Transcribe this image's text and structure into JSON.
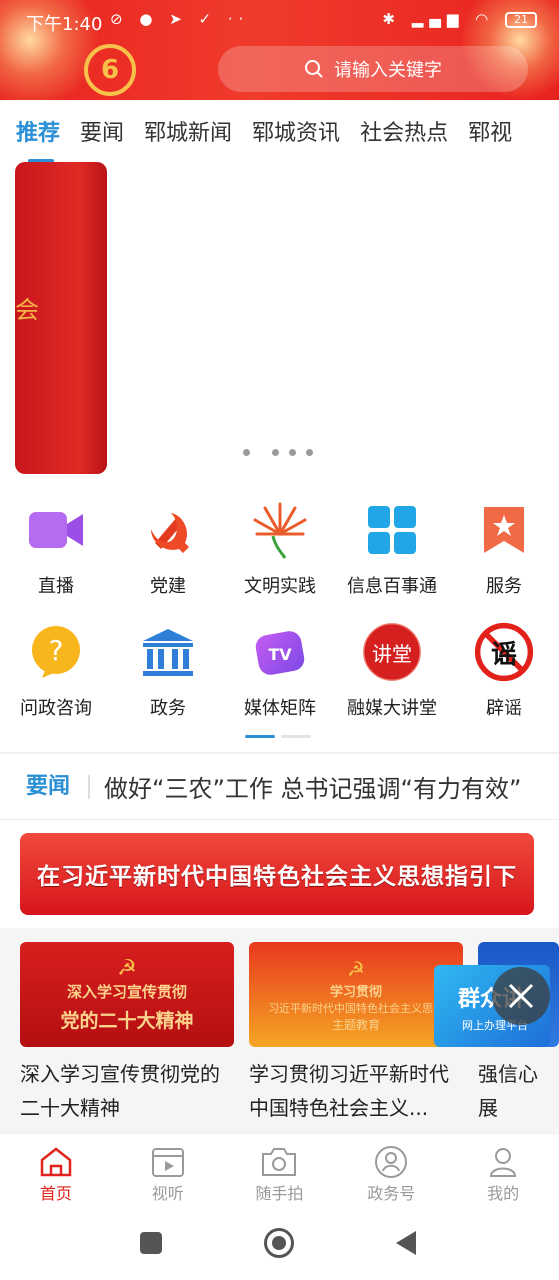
{
  "status_bar": {
    "time": "下午1:40",
    "battery": "21"
  },
  "header": {
    "logo_text": "6",
    "search_placeholder": "请输入关键字"
  },
  "tabs": [
    {
      "label": "推荐",
      "active": true
    },
    {
      "label": "要闻"
    },
    {
      "label": "郓城新闻"
    },
    {
      "label": "郓城资讯"
    },
    {
      "label": "社会热点"
    },
    {
      "label": "郓视"
    }
  ],
  "banner": {
    "text": "会"
  },
  "grid": [
    {
      "label": "直播",
      "icon": "video-icon"
    },
    {
      "label": "党建",
      "icon": "party-emblem-icon"
    },
    {
      "label": "文明实践",
      "icon": "civilization-icon"
    },
    {
      "label": "信息百事通",
      "icon": "grid-four-icon"
    },
    {
      "label": "服务",
      "icon": "bookmark-star-icon"
    },
    {
      "label": "问政咨询",
      "icon": "question-bubble-icon"
    },
    {
      "label": "政务",
      "icon": "government-building-icon"
    },
    {
      "label": "媒体矩阵",
      "icon": "tv-icon"
    },
    {
      "label": "融媒大讲堂",
      "icon": "lecture-icon",
      "badge": "讲堂"
    },
    {
      "label": "辟谣",
      "icon": "rumor-icon",
      "badge": "谣"
    }
  ],
  "ticker": {
    "tag": "要闻",
    "text": "做好“三农”工作  总书记强调“有力有效”"
  },
  "red_banner": {
    "text": "在习近平新时代中国特色社会主义思想指引下"
  },
  "cards": [
    {
      "image_line1": "深入学习宣传贯彻",
      "image_line2": "党的二十大精神",
      "title": "深入学习宣传贯彻党的二十大精神"
    },
    {
      "image_line1": "学习贯彻",
      "image_line2": "习近平新时代中国特色社会主义思想",
      "image_line3": "主题教育",
      "title": "学习贯彻习近平新时代中国特色社会主义..."
    },
    {
      "title": "强信心 展"
    }
  ],
  "floating_ad": {
    "title": "群众讲",
    "subtitle": "网上办理平台"
  },
  "bottom_nav": [
    {
      "label": "首页",
      "icon": "home-icon",
      "active": true
    },
    {
      "label": "视听",
      "icon": "play-icon"
    },
    {
      "label": "随手拍",
      "icon": "camera-icon"
    },
    {
      "label": "政务号",
      "icon": "badge-person-icon"
    },
    {
      "label": "我的",
      "icon": "user-icon"
    }
  ],
  "colors": {
    "brand_red": "#e0231c",
    "accent_blue": "#2b8fd6"
  }
}
